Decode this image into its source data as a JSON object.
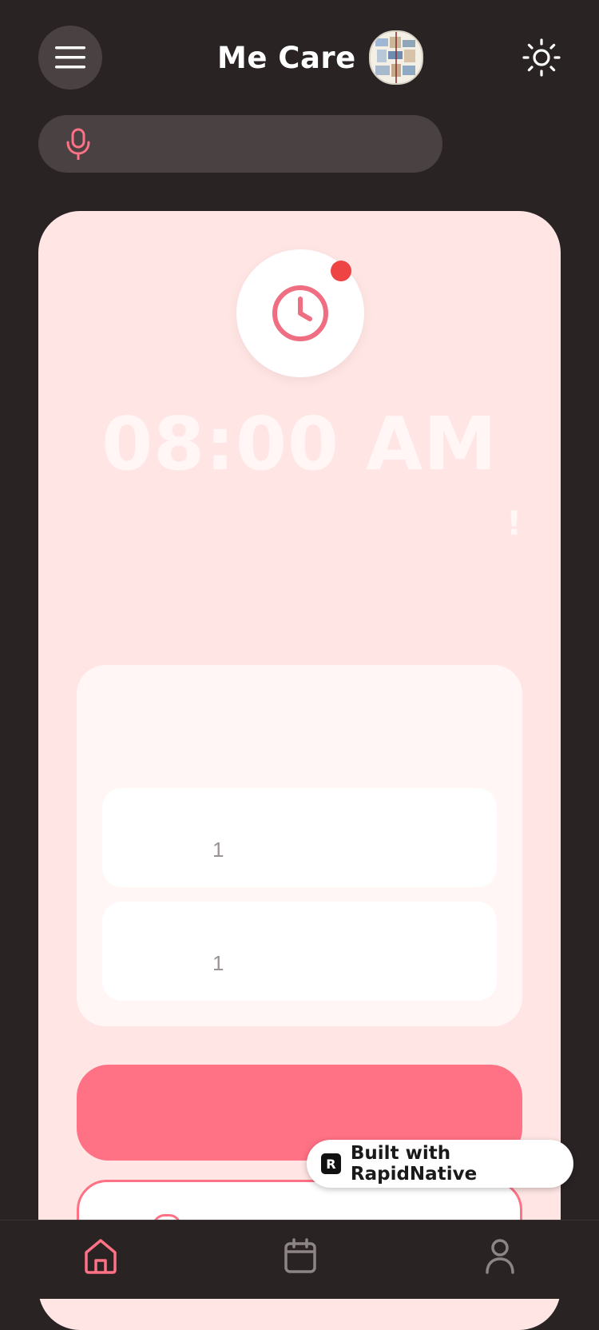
{
  "header": {
    "title": "Me Care",
    "menu_icon": "hamburger-menu-icon",
    "avatar_icon": "collage-avatar",
    "theme_icon": "sun-icon"
  },
  "voice_search": {
    "icon": "microphone-icon",
    "value": ""
  },
  "reminder": {
    "icon": "clock-icon",
    "has_notification": true,
    "time": "08:00 AM",
    "exclamation": "!",
    "details": [
      {
        "value": "1"
      },
      {
        "value": "1"
      }
    ]
  },
  "badge": {
    "logo_letter": "R",
    "text": "Built with RapidNative"
  },
  "tabs": [
    {
      "name": "home",
      "icon": "home-icon",
      "active": true
    },
    {
      "name": "calendar",
      "icon": "calendar-icon",
      "active": false
    },
    {
      "name": "profile",
      "icon": "user-icon",
      "active": false
    }
  ],
  "colors": {
    "background": "#292324",
    "accent": "#ff7185",
    "card": "#ffe6e4",
    "notification": "#ee4444"
  }
}
